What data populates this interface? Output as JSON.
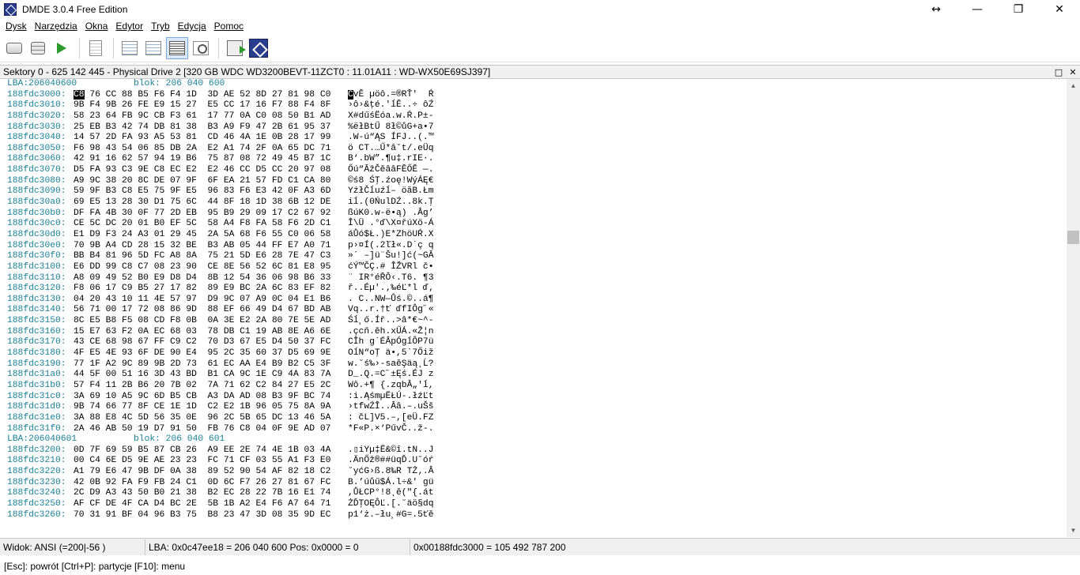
{
  "window": {
    "title": "DMDE 3.0.4 Free Edition",
    "resize_glyph": "↔",
    "minimize_glyph": "—",
    "maximize_glyph": "❐",
    "close_glyph": "✕"
  },
  "menu": [
    "Dysk",
    "Narzędzia",
    "Okna",
    "Edytor",
    "Tryb",
    "Edycja",
    "Pomoc"
  ],
  "toolbar": {
    "icons": [
      "disk-icon",
      "partitions-icon",
      "play-icon",
      "document-icon",
      "list-icon",
      "list2-icon",
      "hex-view-icon",
      "find-icon",
      "export-icon",
      "dmde-logo-icon"
    ],
    "active": "hex-view-icon"
  },
  "panel": {
    "title": "Sektory 0 - 625 142 445 - Physical Drive 2 [320 GB WDC WD3200BEVT-11ZCT0 : 11.01A11 : WD-WX50E69SJ397]",
    "maximize_glyph": "□",
    "close_glyph": "✕"
  },
  "hex_rows": [
    {
      "type": "lba",
      "lba": "LBA:206040600",
      "block": "blok: 206 040 600"
    },
    {
      "addr": "188fdc3000:",
      "first": "C8",
      "hex": " 76 CC 88 B5 F6 F4 1D  3D AE 52 8D 27 81 98 C0",
      "asc_first": "Č",
      "asc": "vĚ µöô.=®RŤ'  Ŕ"
    },
    {
      "addr": "188fdc3010:",
      "hex": "9B F4 9B 26 FE E9 15 27  E5 CC 17 16 F7 88 F4 8F",
      "asc": "›ô›&ţé.'ĺĚ..÷ ôŹ"
    },
    {
      "addr": "188fdc3020:",
      "hex": "58 23 64 FB 9C CB F3 61  17 77 0A C0 08 50 B1 AD",
      "asc": "X#dűśËóa.w.Ŕ.P±-"
    },
    {
      "addr": "188fdc3030:",
      "hex": "25 EB B3 42 74 DB 81 38  B3 A9 F9 47 2B 61 95 37",
      "asc": "%ëłBtŰ 8ł©ůG+a•7"
    },
    {
      "addr": "188fdc3040:",
      "hex": "14 57 2D FA 93 A5 53 81  CD 46 4A 1E 0B 28 17 99",
      "asc": ".W-ú“ĄS ÍFJ..(.™"
    },
    {
      "addr": "188fdc3050:",
      "hex": "F6 98 43 54 06 85 DB 2A  E2 A1 74 2F 0A 65 DC 71",
      "asc": "ö CT.…Ű*â˘t/.eÜq"
    },
    {
      "addr": "188fdc3060:",
      "hex": "42 91 16 62 57 94 19 B6  75 87 08 72 49 45 B7 1C",
      "asc": "B‘.bW”.¶u‡.rIE·."
    },
    {
      "addr": "188fdc3070:",
      "hex": "D5 FA 93 C3 9E C8 EC E2  E2 46 CC D5 CC 20 97 08",
      "asc": "Őú“ĂžČěââFĚŐĚ —."
    },
    {
      "addr": "188fdc3080:",
      "hex": "A9 9C 38 20 8C DE 07 9F  6F EA 21 57 FD C1 CA 80",
      "asc": "©ś8 ŚŢ.źoę!WýÁĘ€"
    },
    {
      "addr": "188fdc3090:",
      "hex": "59 9F B3 C8 E5 75 9F E5  96 83 F6 E3 42 0F A3 6D",
      "asc": "YźłČĺuźĺ– öăB.Łm"
    },
    {
      "addr": "188fdc30a0:",
      "hex": "69 E5 13 28 30 D1 75 6C  44 8F 18 1D 38 6B 12 DE",
      "asc": "iĺ.(0ŃulDŹ..8k.Ţ"
    },
    {
      "addr": "188fdc30b0:",
      "hex": "DF FA 4B 30 0F 77 2D EB  95 B9 29 09 17 C2 67 92",
      "asc": "ßúK0.w-ë•ą) .Âg’"
    },
    {
      "addr": "188fdc30c0:",
      "hex": "CE 5C DC 20 01 B0 EF 5C  58 A4 F8 FA 58 F6 2D C1",
      "asc": "Î\\Ü .°ď\\X¤řúXö-Á"
    },
    {
      "addr": "188fdc30d0:",
      "hex": "E1 D9 F3 24 A3 01 29 45  2A 5A 68 F6 55 C0 06 58",
      "asc": "áŮó$Ł.)E*ZhöUŔ.X"
    },
    {
      "addr": "188fdc30e0:",
      "hex": "70 9B A4 CD 28 15 32 BE  B3 AB 05 44 FF E7 A0 71",
      "asc": "p›¤Í(.2ľł«.D˙ç q"
    },
    {
      "addr": "188fdc30f0:",
      "hex": "BB B4 81 96 5D FC A8 8A  75 21 5D E6 28 7E 47 C3",
      "asc": "»´ –]ü¨Šu!]ć(~GĂ"
    },
    {
      "addr": "188fdc3100:",
      "hex": "E6 DD 99 C8 C7 08 23 90  CE 8E 56 52 6C 81 E8 95",
      "asc": "ćÝ™ČÇ.# ÎŽVRl č•"
    },
    {
      "addr": "188fdc3110:",
      "hex": "A8 09 49 52 B0 E9 D8 D4  8B 12 54 36 06 98 B6 33",
      "asc": "¨ IR°éŘÔ‹.T6. ¶3"
    },
    {
      "addr": "188fdc3120:",
      "hex": "F8 06 17 C9 B5 27 17 82  89 E9 BC 2A 6C 83 EF 82",
      "asc": "ř..Éµ'.‚‰éĽ*l ď‚"
    },
    {
      "addr": "188fdc3130:",
      "hex": "04 20 43 10 11 4E 57 97  D9 9C 07 A9 0C 04 E1 B6",
      "asc": ". C..NW—Ůś.©..á¶"
    },
    {
      "addr": "188fdc3140:",
      "hex": "56 71 00 17 72 08 86 9D  88 EF 66 49 D4 67 BD AB",
      "asc": "Vq..r.†ť ďfIÔg˝«"
    },
    {
      "addr": "188fdc3150:",
      "hex": "8C E5 B8 F5 08 CD F8 0B  0A 3E E2 2A 80 7E 5E AD",
      "asc": "Śĺ¸ő.Íř..>â*€~^-"
    },
    {
      "addr": "188fdc3160:",
      "hex": "15 E7 63 F2 0A EC 68 03  78 DB C1 19 AB 8E A6 6E",
      "asc": ".çcň.ěh.xŰÁ.«Ž¦n"
    },
    {
      "addr": "188fdc3170:",
      "hex": "43 CE 68 98 67 FF C9 C2  70 D3 67 E5 D4 50 37 FC",
      "asc": "CÎh g˙ÉÂpÓgĺÔP7ü"
    },
    {
      "addr": "188fdc3180:",
      "hex": "4F E5 4E 93 6F DE 90 E4  95 2C 35 60 37 D5 69 9E",
      "asc": "OĺN“oŢ ä•,5`7Őiž"
    },
    {
      "addr": "188fdc3190:",
      "hex": "77 1F A2 9C 89 9B 2D 73  61 EC AA E4 B9 B2 C5 3F",
      "asc": "w.˘ś‰›-saěŞäą˛Ĺ?"
    },
    {
      "addr": "188fdc31a0:",
      "hex": "44 5F 00 51 16 3D 43 BD  B1 CA 9C 1E C9 4A 83 7A",
      "asc": "D_.Q.=C˝±Ęś.ÉJ z"
    },
    {
      "addr": "188fdc31b0:",
      "hex": "57 F4 11 2B B6 20 7B 02  7A 71 62 C2 84 27 E5 2C",
      "asc": "Wô.+¶ {.zqbÂ„'ĺ,"
    },
    {
      "addr": "188fdc31c0:",
      "hex": "3A 69 10 A5 9C 6D B5 CB  A3 DA AD 08 B3 9F BC 74",
      "asc": ":i.ĄśmµËŁÚ-.łźĽt"
    },
    {
      "addr": "188fdc31d0:",
      "hex": "9B 74 66 77 8F CE 1E 1D  C2 E2 1B 96 05 75 8A 9A",
      "asc": "›tfwŹÎ..Ââ.–.uŠš"
    },
    {
      "addr": "188fdc31e0:",
      "hex": "3A 88 E8 4C 5D 56 35 0E  96 2C 5B 65 DC 13 46 5A",
      "asc": ": čL]V5.–,[eÜ.FZ"
    },
    {
      "addr": "188fdc31f0:",
      "hex": "2A 46 AB 50 19 D7 91 50  FB 76 C8 04 0F 9E AD 07",
      "asc": "*F«P.×‘PűvČ..ž-."
    },
    {
      "type": "lba",
      "lba": "LBA:206040601",
      "block": "blok: 206 040 601"
    },
    {
      "addr": "188fdc3200:",
      "hex": "0D 7F 69 59 B5 87 CB 26  A9 EE 2E 74 4E 1B 03 4A",
      "asc": ".▯iYµ‡Ë&©î.tN..J"
    },
    {
      "addr": "188fdc3210:",
      "hex": "00 C4 6E D5 9E AE 23 23  FC 71 CF 03 55 A1 F3 E0",
      "asc": ".ÄnŐž®##üqĎ.U˘óŕ"
    },
    {
      "addr": "188fdc3220:",
      "hex": "A1 79 E6 47 9B DF 0A 38  89 52 90 54 AF 82 18 C2",
      "asc": "˘yćG›ß.8‰R TŻ‚.Â"
    },
    {
      "addr": "188fdc3230:",
      "hex": "42 0B 92 FA F9 FB 24 C1  0D 6C F7 26 27 81 67 FC",
      "asc": "B.’úůű$Á.l÷&' gü"
    },
    {
      "addr": "188fdc3240:",
      "hex": "2C D9 A3 43 50 B0 21 38  B2 EC 28 22 7B 16 E1 74",
      "asc": ",ŮŁCP°!8˛ě(\"{.át"
    },
    {
      "addr": "188fdc3250:",
      "hex": "AF CF DE 4F CA D4 BC 2E  5B 1B A2 E4 F6 A7 64 71",
      "asc": "ŻĎŢOĘÔĽ.[.˘äö§dq"
    },
    {
      "addr": "188fdc3260:",
      "hex": "70 31 91 BF 04 96 B3 75  B8 23 47 3D 08 35 9D EC",
      "asc": "p1‘ż.–łu¸#G=.5ťě"
    }
  ],
  "status": {
    "view": "Widok:  ANSI (=200|-56 )",
    "lba": "LBA: 0x0c47ee18 = 206 040 600  Pos: 0x0000 = 0",
    "offset": "0x00188fdc3000 = 105 492 787 200"
  },
  "hints": "[Esc]: powrót  [Ctrl+P]: partycje  [F10]: menu"
}
